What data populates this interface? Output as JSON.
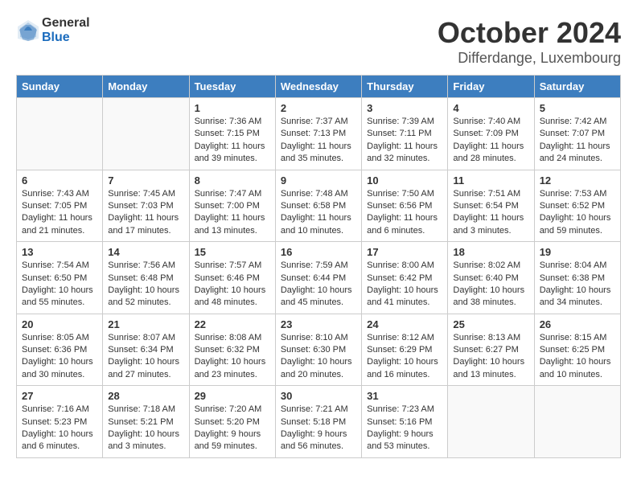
{
  "logo": {
    "text_general": "General",
    "text_blue": "Blue"
  },
  "title": "October 2024",
  "subtitle": "Differdange, Luxembourg",
  "header": {
    "days": [
      "Sunday",
      "Monday",
      "Tuesday",
      "Wednesday",
      "Thursday",
      "Friday",
      "Saturday"
    ]
  },
  "weeks": [
    [
      {
        "day": "",
        "info": ""
      },
      {
        "day": "",
        "info": ""
      },
      {
        "day": "1",
        "info": "Sunrise: 7:36 AM\nSunset: 7:15 PM\nDaylight: 11 hours and 39 minutes."
      },
      {
        "day": "2",
        "info": "Sunrise: 7:37 AM\nSunset: 7:13 PM\nDaylight: 11 hours and 35 minutes."
      },
      {
        "day": "3",
        "info": "Sunrise: 7:39 AM\nSunset: 7:11 PM\nDaylight: 11 hours and 32 minutes."
      },
      {
        "day": "4",
        "info": "Sunrise: 7:40 AM\nSunset: 7:09 PM\nDaylight: 11 hours and 28 minutes."
      },
      {
        "day": "5",
        "info": "Sunrise: 7:42 AM\nSunset: 7:07 PM\nDaylight: 11 hours and 24 minutes."
      }
    ],
    [
      {
        "day": "6",
        "info": "Sunrise: 7:43 AM\nSunset: 7:05 PM\nDaylight: 11 hours and 21 minutes."
      },
      {
        "day": "7",
        "info": "Sunrise: 7:45 AM\nSunset: 7:03 PM\nDaylight: 11 hours and 17 minutes."
      },
      {
        "day": "8",
        "info": "Sunrise: 7:47 AM\nSunset: 7:00 PM\nDaylight: 11 hours and 13 minutes."
      },
      {
        "day": "9",
        "info": "Sunrise: 7:48 AM\nSunset: 6:58 PM\nDaylight: 11 hours and 10 minutes."
      },
      {
        "day": "10",
        "info": "Sunrise: 7:50 AM\nSunset: 6:56 PM\nDaylight: 11 hours and 6 minutes."
      },
      {
        "day": "11",
        "info": "Sunrise: 7:51 AM\nSunset: 6:54 PM\nDaylight: 11 hours and 3 minutes."
      },
      {
        "day": "12",
        "info": "Sunrise: 7:53 AM\nSunset: 6:52 PM\nDaylight: 10 hours and 59 minutes."
      }
    ],
    [
      {
        "day": "13",
        "info": "Sunrise: 7:54 AM\nSunset: 6:50 PM\nDaylight: 10 hours and 55 minutes."
      },
      {
        "day": "14",
        "info": "Sunrise: 7:56 AM\nSunset: 6:48 PM\nDaylight: 10 hours and 52 minutes."
      },
      {
        "day": "15",
        "info": "Sunrise: 7:57 AM\nSunset: 6:46 PM\nDaylight: 10 hours and 48 minutes."
      },
      {
        "day": "16",
        "info": "Sunrise: 7:59 AM\nSunset: 6:44 PM\nDaylight: 10 hours and 45 minutes."
      },
      {
        "day": "17",
        "info": "Sunrise: 8:00 AM\nSunset: 6:42 PM\nDaylight: 10 hours and 41 minutes."
      },
      {
        "day": "18",
        "info": "Sunrise: 8:02 AM\nSunset: 6:40 PM\nDaylight: 10 hours and 38 minutes."
      },
      {
        "day": "19",
        "info": "Sunrise: 8:04 AM\nSunset: 6:38 PM\nDaylight: 10 hours and 34 minutes."
      }
    ],
    [
      {
        "day": "20",
        "info": "Sunrise: 8:05 AM\nSunset: 6:36 PM\nDaylight: 10 hours and 30 minutes."
      },
      {
        "day": "21",
        "info": "Sunrise: 8:07 AM\nSunset: 6:34 PM\nDaylight: 10 hours and 27 minutes."
      },
      {
        "day": "22",
        "info": "Sunrise: 8:08 AM\nSunset: 6:32 PM\nDaylight: 10 hours and 23 minutes."
      },
      {
        "day": "23",
        "info": "Sunrise: 8:10 AM\nSunset: 6:30 PM\nDaylight: 10 hours and 20 minutes."
      },
      {
        "day": "24",
        "info": "Sunrise: 8:12 AM\nSunset: 6:29 PM\nDaylight: 10 hours and 16 minutes."
      },
      {
        "day": "25",
        "info": "Sunrise: 8:13 AM\nSunset: 6:27 PM\nDaylight: 10 hours and 13 minutes."
      },
      {
        "day": "26",
        "info": "Sunrise: 8:15 AM\nSunset: 6:25 PM\nDaylight: 10 hours and 10 minutes."
      }
    ],
    [
      {
        "day": "27",
        "info": "Sunrise: 7:16 AM\nSunset: 5:23 PM\nDaylight: 10 hours and 6 minutes."
      },
      {
        "day": "28",
        "info": "Sunrise: 7:18 AM\nSunset: 5:21 PM\nDaylight: 10 hours and 3 minutes."
      },
      {
        "day": "29",
        "info": "Sunrise: 7:20 AM\nSunset: 5:20 PM\nDaylight: 9 hours and 59 minutes."
      },
      {
        "day": "30",
        "info": "Sunrise: 7:21 AM\nSunset: 5:18 PM\nDaylight: 9 hours and 56 minutes."
      },
      {
        "day": "31",
        "info": "Sunrise: 7:23 AM\nSunset: 5:16 PM\nDaylight: 9 hours and 53 minutes."
      },
      {
        "day": "",
        "info": ""
      },
      {
        "day": "",
        "info": ""
      }
    ]
  ]
}
